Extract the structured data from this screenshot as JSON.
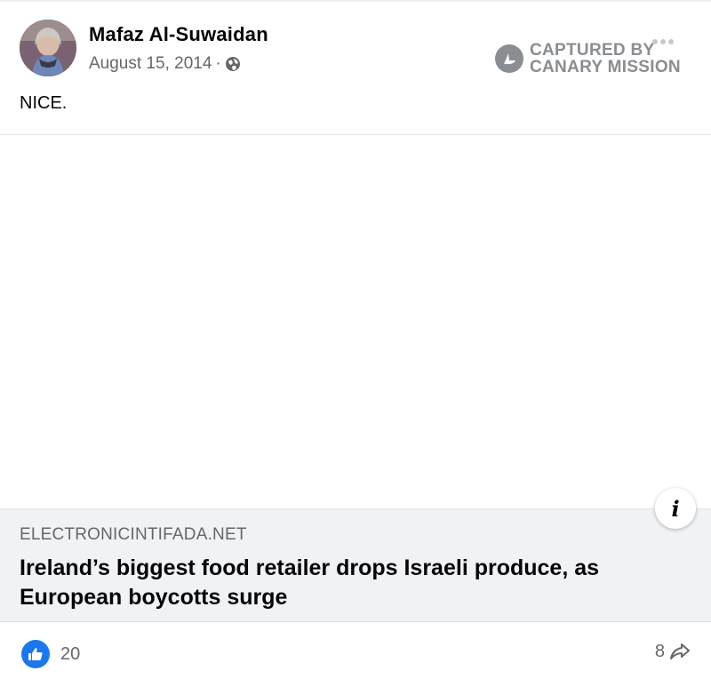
{
  "post": {
    "author": "Mafaz Al-Suwaidan",
    "date": "August 15, 2014",
    "separator": "·",
    "audience_icon": "globe-icon",
    "text": "NICE.",
    "watermark": {
      "line1": "CAPTURED BY",
      "line2": "CANARY MISSION",
      "logo_icon": "canary-bird-icon"
    },
    "more_icon": "more-options-icon"
  },
  "link_preview": {
    "domain": "ELECTRONICINTIFADA.NET",
    "title": "Ireland’s biggest food retailer drops Israeli produce, as European boycotts surge",
    "info_label": "i"
  },
  "footer": {
    "like_count": "20",
    "share_count": "8",
    "like_icon": "thumbs-up-icon",
    "share_icon": "share-arrow-icon"
  },
  "colors": {
    "brand_blue": "#1877f2",
    "muted_text": "#65676b",
    "link_bg": "#f0f2f5",
    "watermark": "#8a8d91"
  }
}
